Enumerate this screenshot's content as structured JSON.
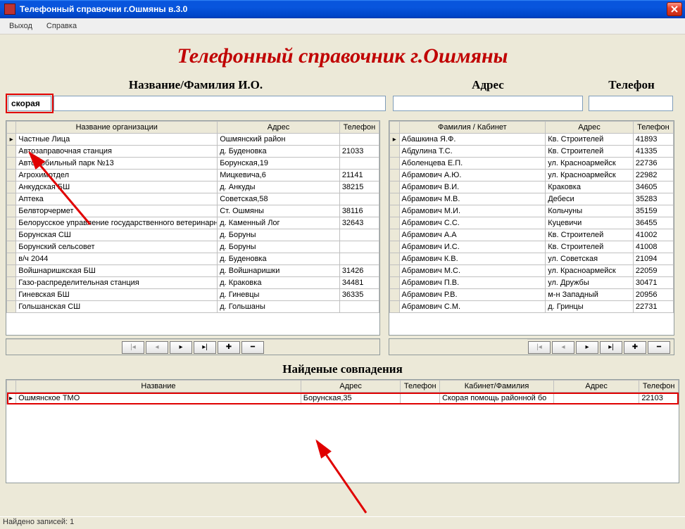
{
  "window": {
    "title": "Телефонный справочни г.Ошмяны в.3.0"
  },
  "menu": {
    "exit": "Выход",
    "help": "Справка"
  },
  "heading": "Телефонный справочник г.Ошмяны",
  "search": {
    "labels": {
      "name": "Название/Фамилия И.О.",
      "address": "Адрес",
      "phone": "Телефон"
    },
    "values": {
      "name": "скорая",
      "address": "",
      "phone": ""
    }
  },
  "grid_org": {
    "headers": {
      "name": "Название организации",
      "addr": "Адрес",
      "phone": "Телефон"
    },
    "rows": [
      {
        "name": "Частные Лица",
        "addr": "Ошмянский район",
        "phone": ""
      },
      {
        "name": "Автозаправочная станция",
        "addr": "д. Буденовка",
        "phone": "21033"
      },
      {
        "name": "Автомобильный парк №13",
        "addr": "Борунская,19",
        "phone": ""
      },
      {
        "name": "Агрохимотдел",
        "addr": "Мицкевича,6",
        "phone": "21141"
      },
      {
        "name": "Анкудская БШ",
        "addr": "д. Анкуды",
        "phone": "38215"
      },
      {
        "name": "Аптека",
        "addr": "Советская,58",
        "phone": ""
      },
      {
        "name": "Белвторчермет",
        "addr": "Ст. Ошмяны",
        "phone": "38116"
      },
      {
        "name": "Белорусское управление государственного ветеринарн",
        "addr": "д. Каменный Лог",
        "phone": "32643"
      },
      {
        "name": "Борунская СШ",
        "addr": "д. Боруны",
        "phone": ""
      },
      {
        "name": "Борунский сельсовет",
        "addr": "д. Боруны",
        "phone": ""
      },
      {
        "name": "в/ч 2044",
        "addr": "д. Буденовка",
        "phone": ""
      },
      {
        "name": "Войшнаришкская БШ",
        "addr": "д. Войшнаришки",
        "phone": "31426"
      },
      {
        "name": "Газо-распределительная станция",
        "addr": "д. Краковка",
        "phone": "34481"
      },
      {
        "name": "Гиневская БШ",
        "addr": "д. Гиневцы",
        "phone": "36335"
      },
      {
        "name": "Гольшанская СШ",
        "addr": "д. Гольшаны",
        "phone": ""
      }
    ]
  },
  "grid_person": {
    "headers": {
      "name": "Фамилия / Кабинет",
      "addr": "Адрес",
      "phone": "Телефон"
    },
    "rows": [
      {
        "name": "Абашкина Я.Ф.",
        "addr": "Кв. Строителей",
        "phone": "41893"
      },
      {
        "name": "Абдулина Т.С.",
        "addr": "Кв. Строителей",
        "phone": "41335"
      },
      {
        "name": "Аболенцева Е.П.",
        "addr": "ул. Красноармейск",
        "phone": "22736"
      },
      {
        "name": "Абрамович  А.Ю.",
        "addr": "ул. Красноармейск",
        "phone": "22982"
      },
      {
        "name": "Абрамович  В.И.",
        "addr": "Краковка",
        "phone": "34605"
      },
      {
        "name": "Абрамович  М.В.",
        "addr": "Дебеси",
        "phone": "35283"
      },
      {
        "name": "Абрамович  М.И.",
        "addr": "Кольчуны",
        "phone": "35159"
      },
      {
        "name": "Абрамович  С.С.",
        "addr": "Куцевичи",
        "phone": "36455"
      },
      {
        "name": "Абрамович А.А",
        "addr": "Кв. Строителей",
        "phone": "41002"
      },
      {
        "name": "Абрамович И.С.",
        "addr": "Кв. Строителей",
        "phone": "41008"
      },
      {
        "name": "Абрамович К.В.",
        "addr": "ул. Советская",
        "phone": "21094"
      },
      {
        "name": "Абрамович М.С.",
        "addr": "ул. Красноармейск",
        "phone": "22059"
      },
      {
        "name": "Абрамович П.В.",
        "addr": "ул. Дружбы",
        "phone": "30471"
      },
      {
        "name": "Абрамович Р.В.",
        "addr": "м-н Западный",
        "phone": "20956"
      },
      {
        "name": "Абрамович С.М.",
        "addr": "д. Гринцы",
        "phone": "22731"
      }
    ]
  },
  "nav": {
    "first": "|◂",
    "prev": "◂",
    "next": "▸",
    "last": "▸|",
    "add": "✚",
    "del": "━"
  },
  "results": {
    "heading": "Найденые совпадения",
    "headers": {
      "name": "Название",
      "addr": "Адрес",
      "phone": "Телефон",
      "cab": "Кабинет/Фамилия",
      "addr2": "Адрес",
      "phone2": "Телефон"
    },
    "rows": [
      {
        "name": "Ошмянское ТМО",
        "addr": "Борунская,35",
        "phone": "",
        "cab": "Скорая помощь районной бо",
        "addr2": "",
        "phone2": "22103"
      }
    ]
  },
  "status": "Найдено записей: 1"
}
